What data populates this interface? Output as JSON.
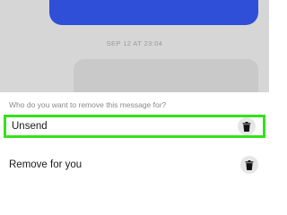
{
  "conversation": {
    "timestamp": "SEP 12 AT 23:04"
  },
  "sheet": {
    "prompt": "Who do you want to remove this message for?",
    "options": [
      {
        "label": "Unsend",
        "icon": "trash-icon"
      },
      {
        "label": "Remove for you",
        "icon": "trash-icon"
      }
    ]
  },
  "colors": {
    "sent_bubble": "#2f4fd8",
    "highlight": "#35e11c"
  }
}
